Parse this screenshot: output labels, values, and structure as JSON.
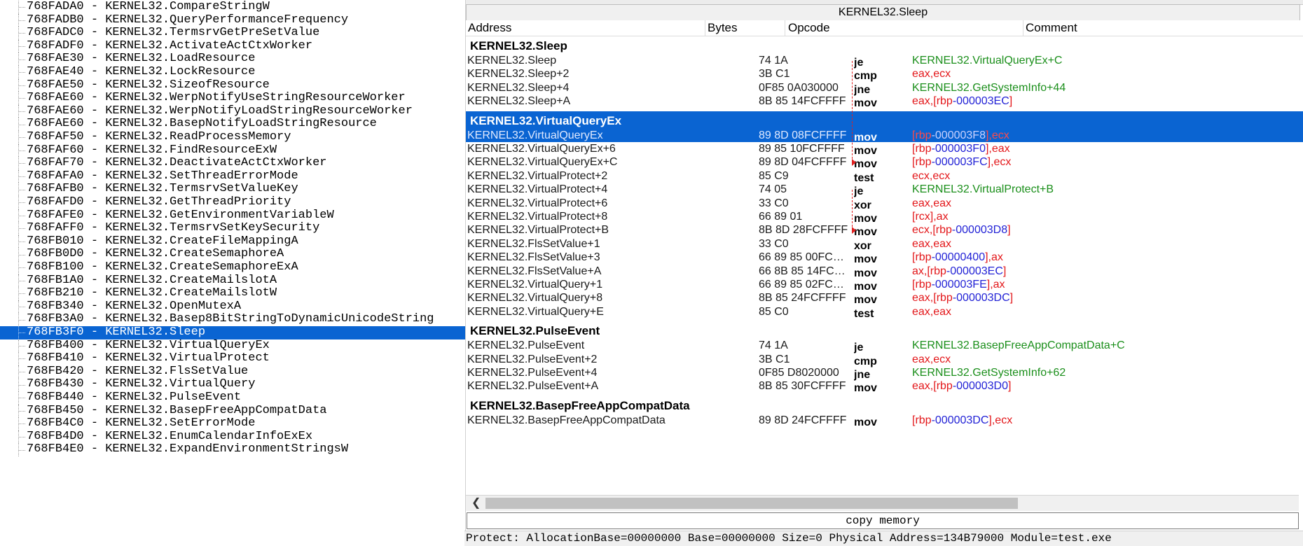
{
  "tree": {
    "items": [
      "768FADA0 - KERNEL32.CompareStringW",
      "768FADB0 - KERNEL32.QueryPerformanceFrequency",
      "768FADC0 - KERNEL32.TermsrvGetPreSetValue",
      "768FADF0 - KERNEL32.ActivateActCtxWorker",
      "768FAE30 - KERNEL32.LoadResource",
      "768FAE40 - KERNEL32.LockResource",
      "768FAE50 - KERNEL32.SizeofResource",
      "768FAE60 - KERNEL32.WerpNotifyUseStringResourceWorker",
      "768FAE60 - KERNEL32.WerpNotifyLoadStringResourceWorker",
      "768FAE60 - KERNEL32.BasepNotifyLoadStringResource",
      "768FAF50 - KERNEL32.ReadProcessMemory",
      "768FAF60 - KERNEL32.FindResourceExW",
      "768FAF70 - KERNEL32.DeactivateActCtxWorker",
      "768FAFA0 - KERNEL32.SetThreadErrorMode",
      "768FAFB0 - KERNEL32.TermsrvSetValueKey",
      "768FAFD0 - KERNEL32.GetThreadPriority",
      "768FAFE0 - KERNEL32.GetEnvironmentVariableW",
      "768FAFF0 - KERNEL32.TermsrvSetKeySecurity",
      "768FB010 - KERNEL32.CreateFileMappingA",
      "768FB0D0 - KERNEL32.CreateSemaphoreA",
      "768FB100 - KERNEL32.CreateSemaphoreExA",
      "768FB1A0 - KERNEL32.CreateMailslotA",
      "768FB210 - KERNEL32.CreateMailslotW",
      "768FB340 - KERNEL32.OpenMutexA",
      "768FB3A0 - KERNEL32.Basep8BitStringToDynamicUnicodeString",
      "768FB3F0 - KERNEL32.Sleep",
      "768FB400 - KERNEL32.VirtualQueryEx",
      "768FB410 - KERNEL32.VirtualProtect",
      "768FB420 - KERNEL32.FlsSetValue",
      "768FB430 - KERNEL32.VirtualQuery",
      "768FB440 - KERNEL32.PulseEvent",
      "768FB450 - KERNEL32.BasepFreeAppCompatData",
      "768FB4C0 - KERNEL32.SetErrorMode",
      "768FB4D0 - KERNEL32.EnumCalendarInfoExEx",
      "768FB4E0 - KERNEL32.ExpandEnvironmentStringsW"
    ],
    "selected_index": 25
  },
  "panel": {
    "title": "KERNEL32.Sleep",
    "columns": {
      "address": "Address",
      "bytes": "Bytes",
      "opcode": "Opcode",
      "comment": "Comment"
    },
    "groups": [
      {
        "name": "KERNEL32.Sleep",
        "rows": [
          {
            "address": "KERNEL32.Sleep",
            "bytes": "74 1A",
            "op": "je",
            "operand": [
              {
                "t": "KERNEL32.VirtualQueryEx+C",
                "c": "green"
              }
            ]
          },
          {
            "address": "KERNEL32.Sleep+2",
            "bytes": "3B C1",
            "op": "cmp",
            "operand": [
              {
                "t": "eax,ecx",
                "c": "red"
              }
            ]
          },
          {
            "address": "KERNEL32.Sleep+4",
            "bytes": "0F85 0A030000",
            "op": "jne",
            "operand": [
              {
                "t": "KERNEL32.GetSystemInfo+44",
                "c": "green"
              }
            ]
          },
          {
            "address": "KERNEL32.Sleep+A",
            "bytes": "8B 85 14FCFFFF",
            "op": "mov",
            "operand": [
              {
                "t": "eax,[",
                "c": "red"
              },
              {
                "t": "rbp",
                "c": "red"
              },
              {
                "t": "-000003EC",
                "c": "blue"
              },
              {
                "t": "]",
                "c": "red"
              }
            ]
          }
        ]
      },
      {
        "name": "KERNEL32.VirtualQueryEx",
        "selected": true,
        "rows": [
          {
            "address": "KERNEL32.VirtualQueryEx",
            "bytes": "89 8D 08FCFFFF",
            "op": "mov",
            "selected": true,
            "operand": [
              {
                "t": "[",
                "c": "red"
              },
              {
                "t": "rbp",
                "c": "red"
              },
              {
                "t": "-000003F8",
                "c": "blue"
              },
              {
                "t": "],ecx",
                "c": "red"
              }
            ]
          },
          {
            "address": "KERNEL32.VirtualQueryEx+6",
            "bytes": "89 85 10FCFFFF",
            "op": "mov",
            "operand": [
              {
                "t": "[",
                "c": "red"
              },
              {
                "t": "rbp",
                "c": "red"
              },
              {
                "t": "-000003F0",
                "c": "blue"
              },
              {
                "t": "],eax",
                "c": "red"
              }
            ]
          },
          {
            "address": "KERNEL32.VirtualQueryEx+C",
            "bytes": "89 8D 04FCFFFF",
            "op": "mov",
            "operand": [
              {
                "t": "[",
                "c": "red"
              },
              {
                "t": "rbp",
                "c": "red"
              },
              {
                "t": "-000003FC",
                "c": "blue"
              },
              {
                "t": "],ecx",
                "c": "red"
              }
            ]
          },
          {
            "address": "KERNEL32.VirtualProtect+2",
            "bytes": "85 C9",
            "op": "test",
            "operand": [
              {
                "t": "ecx,ecx",
                "c": "red"
              }
            ]
          },
          {
            "address": "KERNEL32.VirtualProtect+4",
            "bytes": "74 05",
            "op": "je",
            "operand": [
              {
                "t": "KERNEL32.VirtualProtect+B",
                "c": "green"
              }
            ]
          },
          {
            "address": "KERNEL32.VirtualProtect+6",
            "bytes": "33 C0",
            "op": "xor",
            "operand": [
              {
                "t": "eax,eax",
                "c": "red"
              }
            ]
          },
          {
            "address": "KERNEL32.VirtualProtect+8",
            "bytes": "66 89 01",
            "op": "mov",
            "operand": [
              {
                "t": "[",
                "c": "red"
              },
              {
                "t": "rcx",
                "c": "red"
              },
              {
                "t": "],ax",
                "c": "red"
              }
            ]
          },
          {
            "address": "KERNEL32.VirtualProtect+B",
            "bytes": "8B 8D 28FCFFFF",
            "op": "mov",
            "operand": [
              {
                "t": "ecx,[",
                "c": "red"
              },
              {
                "t": "rbp",
                "c": "red"
              },
              {
                "t": "-000003D8",
                "c": "blue"
              },
              {
                "t": "]",
                "c": "red"
              }
            ]
          },
          {
            "address": "KERNEL32.FlsSetValue+1",
            "bytes": "33 C0",
            "op": "xor",
            "operand": [
              {
                "t": "eax,eax",
                "c": "red"
              }
            ]
          },
          {
            "address": "KERNEL32.FlsSetValue+3",
            "bytes": "66 89 85 00FC…",
            "op": "mov",
            "operand": [
              {
                "t": "[",
                "c": "red"
              },
              {
                "t": "rbp",
                "c": "red"
              },
              {
                "t": "-00000400",
                "c": "blue"
              },
              {
                "t": "],ax",
                "c": "red"
              }
            ]
          },
          {
            "address": "KERNEL32.FlsSetValue+A",
            "bytes": "66 8B 85 14FC…",
            "op": "mov",
            "operand": [
              {
                "t": "ax,[",
                "c": "red"
              },
              {
                "t": "rbp",
                "c": "red"
              },
              {
                "t": "-000003EC",
                "c": "blue"
              },
              {
                "t": "]",
                "c": "red"
              }
            ]
          },
          {
            "address": "KERNEL32.VirtualQuery+1",
            "bytes": "66 89 85 02FC…",
            "op": "mov",
            "operand": [
              {
                "t": "[",
                "c": "red"
              },
              {
                "t": "rbp",
                "c": "red"
              },
              {
                "t": "-000003FE",
                "c": "blue"
              },
              {
                "t": "],ax",
                "c": "red"
              }
            ]
          },
          {
            "address": "KERNEL32.VirtualQuery+8",
            "bytes": "8B 85 24FCFFFF",
            "op": "mov",
            "operand": [
              {
                "t": "eax,[",
                "c": "red"
              },
              {
                "t": "rbp",
                "c": "red"
              },
              {
                "t": "-000003DC",
                "c": "blue"
              },
              {
                "t": "]",
                "c": "red"
              }
            ]
          },
          {
            "address": "KERNEL32.VirtualQuery+E",
            "bytes": "85 C0",
            "op": "test",
            "operand": [
              {
                "t": "eax,eax",
                "c": "red"
              }
            ]
          }
        ]
      },
      {
        "name": "KERNEL32.PulseEvent",
        "rows": [
          {
            "address": "KERNEL32.PulseEvent",
            "bytes": "74 1A",
            "op": "je",
            "operand": [
              {
                "t": "KERNEL32.BasepFreeAppCompatData+C",
                "c": "green"
              }
            ]
          },
          {
            "address": "KERNEL32.PulseEvent+2",
            "bytes": "3B C1",
            "op": "cmp",
            "operand": [
              {
                "t": "eax,ecx",
                "c": "red"
              }
            ]
          },
          {
            "address": "KERNEL32.PulseEvent+4",
            "bytes": "0F85 D8020000",
            "op": "jne",
            "operand": [
              {
                "t": "KERNEL32.GetSystemInfo+62",
                "c": "green"
              }
            ]
          },
          {
            "address": "KERNEL32.PulseEvent+A",
            "bytes": "8B 85 30FCFFFF",
            "op": "mov",
            "operand": [
              {
                "t": "eax,[",
                "c": "red"
              },
              {
                "t": "rbp",
                "c": "red"
              },
              {
                "t": "-000003D0",
                "c": "blue"
              },
              {
                "t": "]",
                "c": "red"
              }
            ]
          }
        ]
      },
      {
        "name": "KERNEL32.BasepFreeAppCompatData",
        "rows": [
          {
            "address": "KERNEL32.BasepFreeAppCompatData",
            "bytes": "89 8D 24FCFFFF",
            "op": "mov",
            "operand": [
              {
                "t": "[",
                "c": "red"
              },
              {
                "t": "rbp",
                "c": "red"
              },
              {
                "t": "-000003DC",
                "c": "blue"
              },
              {
                "t": "],ecx",
                "c": "red"
              }
            ]
          }
        ]
      }
    ],
    "copy_memory_label": "copy memory",
    "status_text": "Protect: AllocationBase=00000000 Base=00000000 Size=0 Physical Address=134B79000 Module=test.exe",
    "colors": {
      "selection": "#0a64d2",
      "operand_green": "#1b8f1b",
      "operand_red": "#e3171a",
      "operand_blue": "#2222d6"
    }
  }
}
